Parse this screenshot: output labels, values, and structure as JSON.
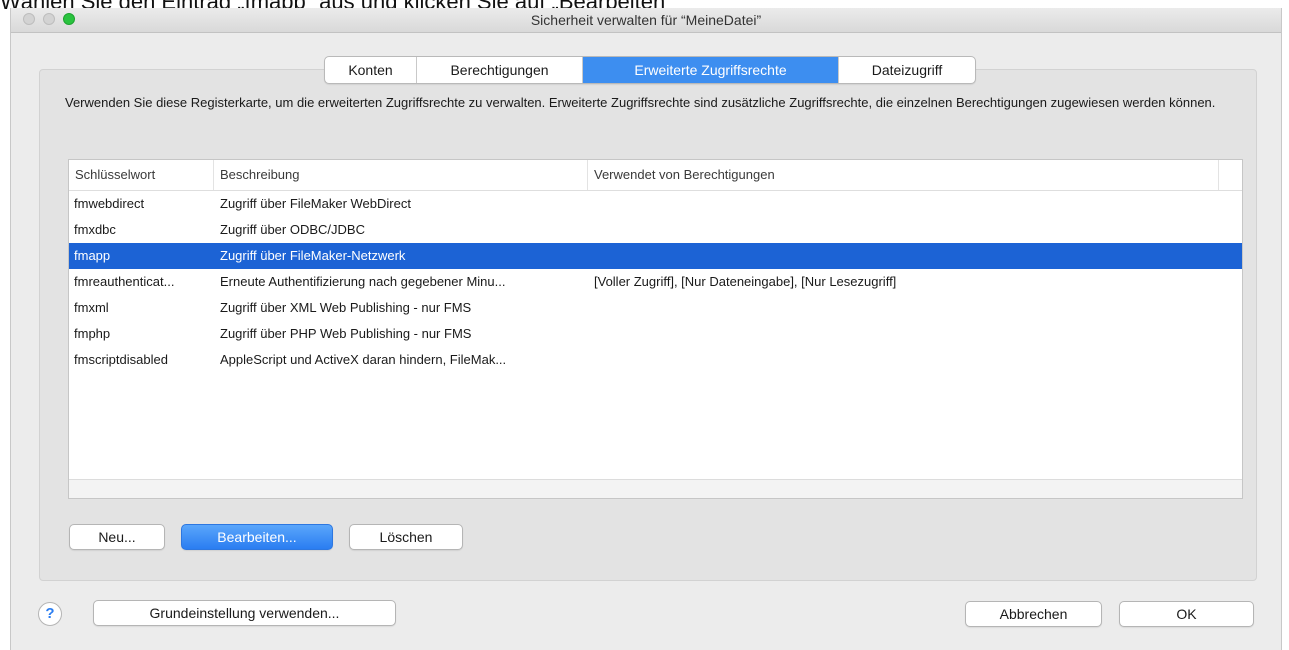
{
  "caption": "Wählen Sie den Eintrag „fmapp“ aus und klicken Sie auf „Bearbeiten“",
  "window": {
    "title": "Sicherheit verwalten für “MeineDatei”"
  },
  "tabs": [
    {
      "label": "Konten",
      "active": false
    },
    {
      "label": "Berechtigungen",
      "active": false
    },
    {
      "label": "Erweiterte Zugriffsrechte",
      "active": true
    },
    {
      "label": "Dateizugriff",
      "active": false
    }
  ],
  "description": "Verwenden Sie diese Registerkarte, um die erweiterten Zugriffsrechte zu verwalten. Erweiterte Zugriffsrechte sind zusätzliche Zugriffsrechte, die einzelnen Berechtigungen zugewiesen werden können.",
  "table": {
    "columns": [
      "Schlüsselwort",
      "Beschreibung",
      "Verwendet von Berechtigungen"
    ],
    "rows": [
      {
        "keyword": "fmwebdirect",
        "description": "Zugriff über FileMaker WebDirect",
        "used_by": "",
        "selected": false
      },
      {
        "keyword": "fmxdbc",
        "description": "Zugriff über ODBC/JDBC",
        "used_by": "",
        "selected": false
      },
      {
        "keyword": "fmapp",
        "description": "Zugriff über FileMaker-Netzwerk",
        "used_by": "",
        "selected": true
      },
      {
        "keyword": "fmreauthenticat...",
        "description": "Erneute Authentifizierung nach gegebener Minu...",
        "used_by": "[Voller Zugriff], [Nur Dateneingabe], [Nur Lesezugriff]",
        "selected": false
      },
      {
        "keyword": "fmxml",
        "description": "Zugriff über XML Web Publishing - nur FMS",
        "used_by": "",
        "selected": false
      },
      {
        "keyword": "fmphp",
        "description": "Zugriff über PHP Web Publishing - nur FMS",
        "used_by": "",
        "selected": false
      },
      {
        "keyword": "fmscriptdisabled",
        "description": "AppleScript und ActiveX daran hindern, FileMak...",
        "used_by": "",
        "selected": false
      }
    ]
  },
  "actions": {
    "new_label": "Neu...",
    "edit_label": "Bearbeiten...",
    "delete_label": "Löschen"
  },
  "footer": {
    "help_label": "?",
    "defaults_label": "Grundeinstellung verwenden...",
    "cancel_label": "Abbrechen",
    "ok_label": "OK"
  },
  "colors": {
    "accent": "#2a7df1",
    "selection": "#1c63d5",
    "active_tab": "#3d8ef0",
    "zoom_button": "#2ac33f"
  }
}
